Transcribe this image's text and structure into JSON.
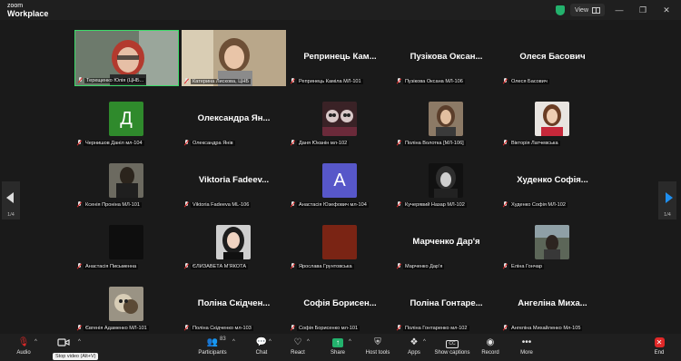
{
  "app": {
    "logo_line1": "zoom",
    "logo_line2": "Workplace"
  },
  "titlebar": {
    "view_label": "View",
    "minimize": "—",
    "maximize": "❐",
    "close": "✕"
  },
  "pager": {
    "left": "1/4",
    "right": "1/4"
  },
  "tiles": [
    {
      "caption": "Терещенко Юлія (ЦНБ...",
      "type": "video"
    },
    {
      "caption": "Катерина Лискова, ЦНБ",
      "type": "video"
    },
    {
      "caption": "Репринець Каміла МЛ-101",
      "big": "Репринець Кам...",
      "type": "name"
    },
    {
      "caption": "Пузікова Оксана МЛ-106",
      "big": "Пузікова Оксан...",
      "type": "name"
    },
    {
      "caption": "Олеся Басович",
      "big": "Олеся Басович",
      "type": "name"
    },
    {
      "caption": "Чернишов Даніл мл-104",
      "letter": "Д",
      "color": "#2f8a2c",
      "type": "letter"
    },
    {
      "caption": "Олександра Янів",
      "big": "Олександра Ян...",
      "type": "name"
    },
    {
      "caption": "Даня Юканін мл-102",
      "type": "photo",
      "color": "#3a2226"
    },
    {
      "caption": "Поліна Волотка [МЛ-106]",
      "type": "photo",
      "color": "#8c7a66"
    },
    {
      "caption": "Вікторія Латчевська",
      "type": "photo",
      "color": "#c9b7a8"
    },
    {
      "caption": "Ксенія Проніна МЛ-101",
      "type": "photo",
      "color": "#6c6a60"
    },
    {
      "caption": "Viktoria Fadeeva ML-106",
      "big": "Viktoria Fadeev...",
      "type": "name"
    },
    {
      "caption": "Анастасія Юзефович мл-104",
      "letter": "A",
      "color": "#5757c9",
      "type": "letter"
    },
    {
      "caption": "Кучерявий Назар МЛ-102",
      "type": "photo",
      "color": "#3b3b3b"
    },
    {
      "caption": "Худенко Софія МЛ-102",
      "big": "Худенко Софія...",
      "type": "name"
    },
    {
      "caption": "Анастасія Письменна",
      "type": "photo",
      "color": "#0e0e0e"
    },
    {
      "caption": "ЄЛИЗАВЕТА М'ЯКОТА",
      "type": "photo",
      "color": "#5a5a5a"
    },
    {
      "caption": "Ярослава Грунтовська",
      "type": "photo",
      "color": "#7a2414"
    },
    {
      "caption": "Марченко Дар'я",
      "big": "Марченко Дар'я",
      "type": "name"
    },
    {
      "caption": "Еліна Гончар",
      "type": "photo",
      "color": "#5c6658"
    },
    {
      "caption": "Євгенія Адаменко МЛ-101",
      "type": "photo",
      "color": "#9a9384"
    },
    {
      "caption": "Поліна Скідченко мл-103",
      "big": "Поліна Скідчен...",
      "type": "name"
    },
    {
      "caption": "Софія Борисенко мл-101",
      "big": "Софія Борисен...",
      "type": "name"
    },
    {
      "caption": "Поліна Гонтаренко мл-102",
      "big": "Поліна Гонтаре...",
      "type": "name"
    },
    {
      "caption": "Ангеліна Михайленко Мл-105",
      "big": "Ангеліна Миха...",
      "type": "name"
    }
  ],
  "toolbar": {
    "audio": "Audio",
    "stop_video": "",
    "participants": "Participants",
    "participants_count": "83",
    "chat": "Chat",
    "react": "React",
    "share": "Share",
    "host_tools": "Host tools",
    "apps": "Apps",
    "show_captions": "Show captions",
    "record": "Record",
    "more": "More",
    "end": "End",
    "tooltip": "Stop video (Alt+V)",
    "share_color": "#23b26d",
    "end_color": "#e02828"
  }
}
